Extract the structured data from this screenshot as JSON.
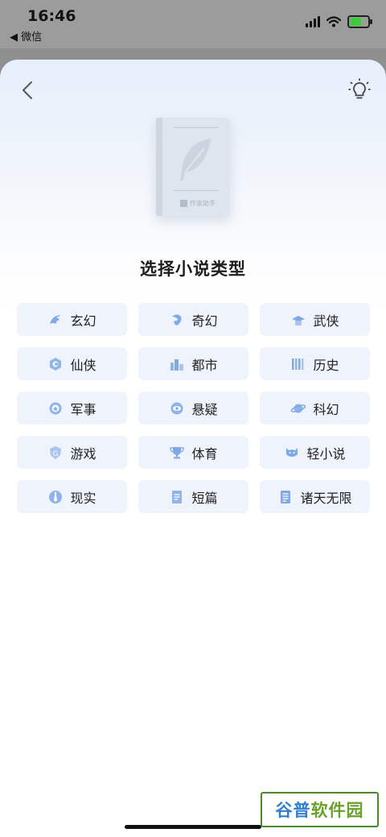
{
  "status_bar": {
    "time": "16:46",
    "back_label": "◀ 微信",
    "battery_color": "#3ec93e"
  },
  "sheet": {
    "back_icon": "chevron-left-icon",
    "tip_icon": "lightbulb-icon",
    "book_brand": "作家助手",
    "title": "选择小说类型",
    "accent_color": "#6fa0e8",
    "chip_bg": "#eef3fc"
  },
  "categories": [
    {
      "label": "玄幻",
      "icon": "dragon-icon"
    },
    {
      "label": "奇幻",
      "icon": "wyvern-icon"
    },
    {
      "label": "武侠",
      "icon": "hat-icon"
    },
    {
      "label": "仙侠",
      "icon": "gourd-icon"
    },
    {
      "label": "都市",
      "icon": "city-icon"
    },
    {
      "label": "历史",
      "icon": "bamboo-scroll-icon"
    },
    {
      "label": "军事",
      "icon": "military-badge-icon"
    },
    {
      "label": "悬疑",
      "icon": "eye-icon"
    },
    {
      "label": "科幻",
      "icon": "planet-icon"
    },
    {
      "label": "游戏",
      "icon": "gamepad-icon"
    },
    {
      "label": "体育",
      "icon": "trophy-icon"
    },
    {
      "label": "轻小说",
      "icon": "cat-icon"
    },
    {
      "label": "现实",
      "icon": "tie-icon"
    },
    {
      "label": "短篇",
      "icon": "short-doc-icon"
    },
    {
      "label": "诸天无限",
      "icon": "long-doc-icon"
    }
  ],
  "watermark": {
    "part1": "谷普",
    "part2": "软件园"
  }
}
